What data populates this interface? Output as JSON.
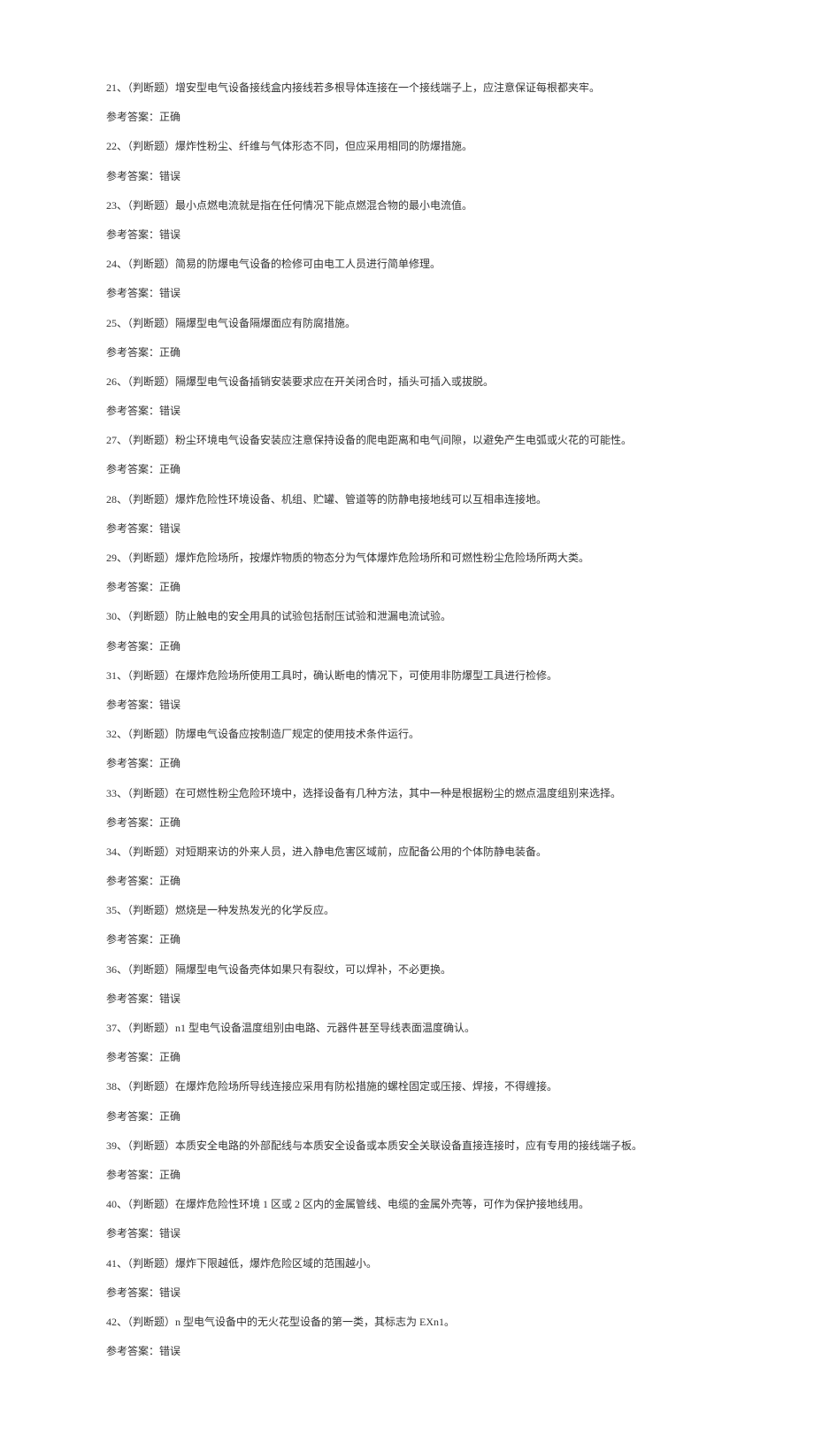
{
  "items": [
    {
      "num": "21",
      "type": "（判断题）",
      "question": "增安型电气设备接线盒内接线若多根导体连接在一个接线端子上，应注意保证每根都夹牢。",
      "answer": "正确"
    },
    {
      "num": "22",
      "type": "（判断题）",
      "question": "爆炸性粉尘、纤维与气体形态不同，但应采用相同的防爆措施。",
      "answer": "错误"
    },
    {
      "num": "23",
      "type": "（判断题）",
      "question": "最小点燃电流就是指在任何情况下能点燃混合物的最小电流值。",
      "answer": "错误"
    },
    {
      "num": "24",
      "type": "（判断题）",
      "question": "简易的防爆电气设备的检修可由电工人员进行简单修理。",
      "answer": "错误"
    },
    {
      "num": "25",
      "type": "（判断题）",
      "question": "隔爆型电气设备隔爆面应有防腐措施。",
      "answer": "正确"
    },
    {
      "num": "26",
      "type": "（判断题）",
      "question": "隔爆型电气设备插销安装要求应在开关闭合时，插头可插入或拔脱。",
      "answer": "错误"
    },
    {
      "num": "27",
      "type": "（判断题）",
      "question": "粉尘环境电气设备安装应注意保持设备的爬电距离和电气间隙，以避免产生电弧或火花的可能性。",
      "answer": "正确"
    },
    {
      "num": "28",
      "type": "（判断题）",
      "question": "爆炸危险性环境设备、机组、贮罐、管道等的防静电接地线可以互相串连接地。",
      "answer": "错误"
    },
    {
      "num": "29",
      "type": "（判断题）",
      "question": "爆炸危险场所，按爆炸物质的物态分为气体爆炸危险场所和可燃性粉尘危险场所两大类。",
      "answer": "正确"
    },
    {
      "num": "30",
      "type": "（判断题）",
      "question": "防止触电的安全用具的试验包括耐压试验和泄漏电流试验。",
      "answer": "正确"
    },
    {
      "num": "31",
      "type": "（判断题）",
      "question": "在爆炸危险场所使用工具时，确认断电的情况下，可使用非防爆型工具进行检修。",
      "answer": "错误"
    },
    {
      "num": "32",
      "type": "（判断题）",
      "question": "防爆电气设备应按制造厂规定的使用技术条件运行。",
      "answer": "正确"
    },
    {
      "num": "33",
      "type": "（判断题）",
      "question": "在可燃性粉尘危险环境中，选择设备有几种方法，其中一种是根据粉尘的燃点温度组别来选择。",
      "answer": "正确"
    },
    {
      "num": "34",
      "type": "（判断题）",
      "question": "对短期来访的外来人员，进入静电危害区域前，应配备公用的个体防静电装备。",
      "answer": "正确"
    },
    {
      "num": "35",
      "type": "（判断题）",
      "question": "燃烧是一种发热发光的化学反应。",
      "answer": "正确"
    },
    {
      "num": "36",
      "type": "（判断题）",
      "question": "隔爆型电气设备壳体如果只有裂纹，可以焊补，不必更换。",
      "answer": "错误"
    },
    {
      "num": "37",
      "type": "（判断题）",
      "question": "n1 型电气设备温度组别由电路、元器件甚至导线表面温度确认。",
      "answer": "正确"
    },
    {
      "num": "38",
      "type": "（判断题）",
      "question": "在爆炸危险场所导线连接应采用有防松措施的螺栓固定或压接、焊接，不得缠接。",
      "answer": "正确"
    },
    {
      "num": "39",
      "type": "（判断题）",
      "question": "本质安全电路的外部配线与本质安全设备或本质安全关联设备直接连接时，应有专用的接线端子板。",
      "answer": "正确"
    },
    {
      "num": "40",
      "type": "（判断题）",
      "question": "在爆炸危险性环境 1 区或 2 区内的金属管线、电缆的金属外壳等，可作为保护接地线用。",
      "answer": "错误"
    },
    {
      "num": "41",
      "type": "（判断题）",
      "question": "爆炸下限越低，爆炸危险区域的范围越小。",
      "answer": "错误"
    },
    {
      "num": "42",
      "type": "（判断题）",
      "question": "n 型电气设备中的无火花型设备的第一类，其标志为 EXn1。",
      "answer": "错误"
    }
  ],
  "answerPrefix": "参考答案："
}
